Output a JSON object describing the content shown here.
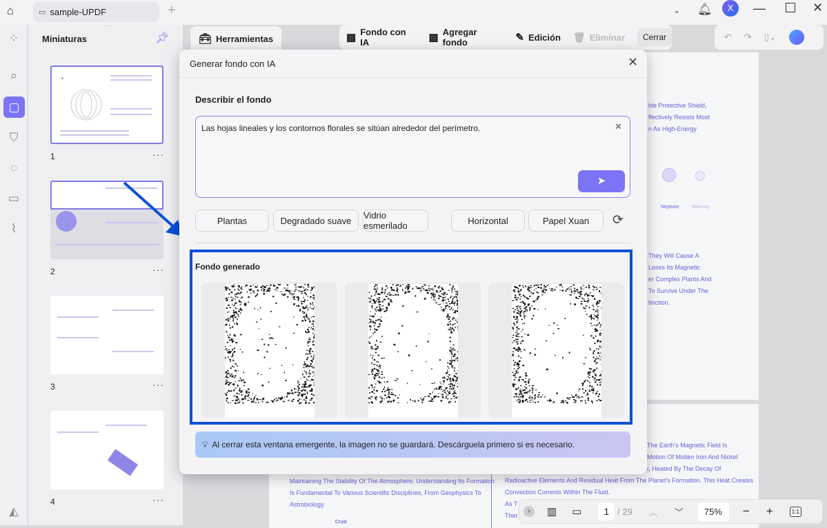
{
  "titlebar": {
    "tab_title": "sample-UPDF",
    "avatar_letter": "X"
  },
  "sidebar": {
    "title": "Miniaturas",
    "pages": [
      "1",
      "2",
      "3",
      "4"
    ]
  },
  "toolbar": {
    "tools_label": "Herramientas",
    "ai_bg_label": "Fondo con IA",
    "add_bg_label": "Agregar fondo",
    "edit_label": "Edición",
    "delete_label": "Eliminar",
    "close_label": "Cerrar"
  },
  "dialog": {
    "title": "Generar fondo con IA",
    "describe_label": "Describir el fondo",
    "prompt_value": "Las hojas lineales y los contornos florales se sitúan alrededor del perímetro.",
    "chips": [
      "Plantas",
      "Degradado suave",
      "Vidrio esmerilado",
      "Horizontal",
      "Papel Xuan"
    ],
    "generated_label": "Fondo generado",
    "notice": "Al cerrar esta ventana emergente, la imagen no se guardará. Descárguela primero si es necesario."
  },
  "document": {
    "right_lines": [
      "ble Protective Shield,",
      "ffectively Resists Most",
      "n As High-Energy",
      "They Will Cause A",
      "Loses Its Magnetic",
      "er Complex Plants And",
      "To Survive Under The",
      "tinction."
    ],
    "planet_labels": [
      "Neptune",
      "Mercury"
    ],
    "lower_left": [
      "Maintaining The Stability Of The Atmosphere. Understanding Its Formation",
      "Is Fundamental To Various Scientific Disciplines, From Geophysics To",
      "Astrobiology."
    ],
    "crust_label": "Crust",
    "lower_right": [
      "The Earth's Magnetic Field Is",
      "Motion Of Molten Iron And Nickel",
      "r, Heated By The Decay Of",
      "Radioactive Elements And Residual Heat From The Planet's Formation. This Heat Creates",
      "Convection Currents Within The Fluid.",
      "As T",
      "Ther"
    ]
  },
  "pager": {
    "current_page": "1",
    "total": "/ 29",
    "zoom": "75%"
  },
  "colors": {
    "accent": "#7b74f6",
    "highlight": "#0b4fd8"
  }
}
